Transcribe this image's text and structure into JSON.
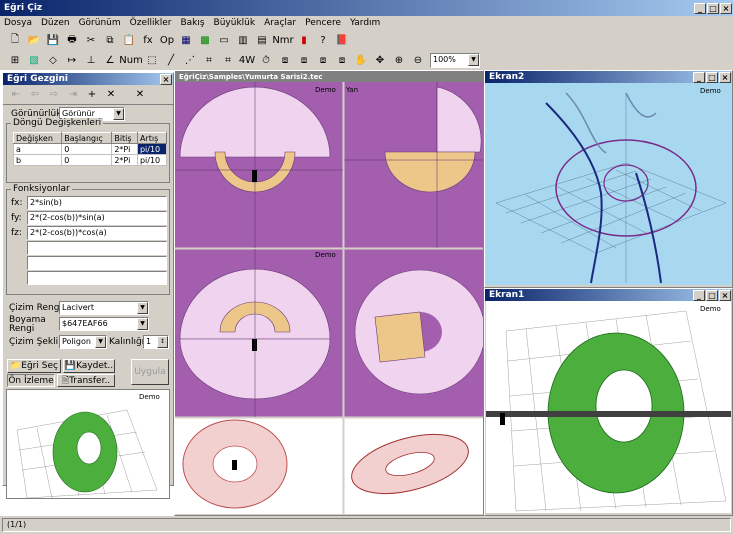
{
  "app": {
    "title": "Eğri Çiz"
  },
  "menu": [
    "Dosya",
    "Düzen",
    "Görünüm",
    "Özellikler",
    "Bakış",
    "Büyüklük",
    "Araçlar",
    "Pencere",
    "Yardım"
  ],
  "toolbar": {
    "fx": "fx",
    "op": "Op",
    "nmr": "Nmr",
    "num": "Num",
    "w4": "4W",
    "zoom": "100%"
  },
  "panel": {
    "title": "Eğri Gezgini",
    "visibility_label": "Görünürlük",
    "visibility_value": "Görünür",
    "loop_group": "Döngü Değişkenleri",
    "loop_headers": [
      "Değişken",
      "Başlangıç",
      "Bitiş",
      "Artış"
    ],
    "loop_rows": [
      [
        "a",
        "0",
        "2*Pi",
        "pi/10"
      ],
      [
        "b",
        "0",
        "2*Pi",
        "pi/10"
      ]
    ],
    "func_group": "Fonksiyonlar",
    "fx_label": "fx:",
    "fx": "2*sin(b)",
    "fy_label": "fy:",
    "fy": "2*(2-cos(b))*sin(a)",
    "fz_label": "fz:",
    "fz": "2*(2-cos(b))*cos(a)",
    "draw_color_label": "Çizim Rengi",
    "draw_color": "Lacivert",
    "paint_color_label": "Boyama Rengi",
    "paint_color": "$647EAF66",
    "draw_shape_label": "Çizim Şekli",
    "draw_shape": "Poligon",
    "thickness_label": "Kalınlığı",
    "thickness": "1",
    "select_btn": "Eğri Seç",
    "save_btn": "Kaydet..",
    "apply_btn": "Uygula",
    "preview_tab": "Ön İzleme",
    "transfer_btn": "Transfer..",
    "demo": "Demo"
  },
  "mdi": {
    "title": "EğriÇiz\\Samples\\Yumurta Sarisi2.tec",
    "demo": "Demo",
    "yan": "Yan"
  },
  "ekran2": {
    "title": "Ekran2",
    "demo": "Demo"
  },
  "ekran1": {
    "title": "Ekran1",
    "demo": "Demo"
  },
  "status": {
    "page": "(1/1)"
  },
  "colors": {
    "titlebar": "#0a246a",
    "viewport_purple": "#a35fae",
    "torus_green": "#4cae3c",
    "torus_orange": "#e8c080",
    "sky": "#a8d8f0"
  }
}
